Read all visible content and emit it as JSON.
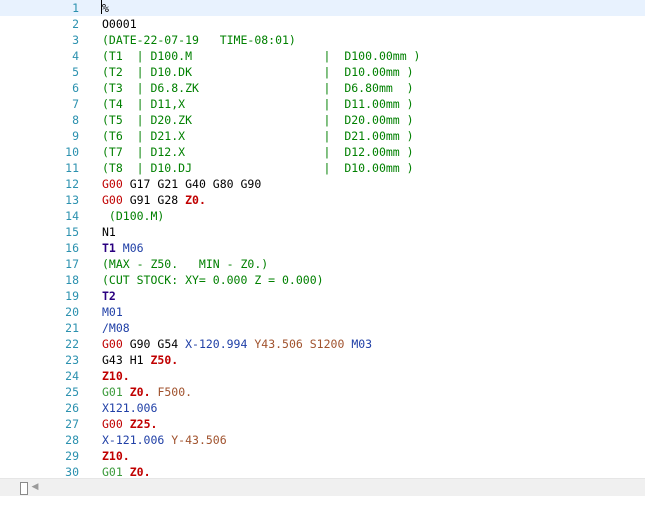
{
  "editor": {
    "lines": [
      {
        "n": "1",
        "tokens": [
          {
            "t": "%",
            "c": "pct"
          }
        ]
      },
      {
        "n": "2",
        "tokens": [
          {
            "t": "O0001",
            "c": "plain"
          }
        ]
      },
      {
        "n": "3",
        "tokens": [
          {
            "t": "(DATE-22-07-19   TIME-08:01)",
            "c": "comment"
          }
        ]
      },
      {
        "n": "4",
        "tokens": [
          {
            "t": "(T1  | D100.M                   |  D100.00mm )",
            "c": "comment"
          }
        ]
      },
      {
        "n": "5",
        "tokens": [
          {
            "t": "(T2  | D10.DK                   |  D10.00mm )",
            "c": "comment"
          }
        ]
      },
      {
        "n": "6",
        "tokens": [
          {
            "t": "(T3  | D6.8.ZK                  |  D6.80mm  )",
            "c": "comment"
          }
        ]
      },
      {
        "n": "7",
        "tokens": [
          {
            "t": "(T4  | D11,X                    |  D11.00mm )",
            "c": "comment"
          }
        ]
      },
      {
        "n": "8",
        "tokens": [
          {
            "t": "(T5  | D20.ZK                   |  D20.00mm )",
            "c": "comment"
          }
        ]
      },
      {
        "n": "9",
        "tokens": [
          {
            "t": "(T6  | D21.X                    |  D21.00mm )",
            "c": "comment"
          }
        ]
      },
      {
        "n": "10",
        "tokens": [
          {
            "t": "(T7  | D12.X                    |  D12.00mm )",
            "c": "comment"
          }
        ]
      },
      {
        "n": "11",
        "tokens": [
          {
            "t": "(T8  | D10.DJ                   |  D10.00mm )",
            "c": "comment"
          }
        ]
      },
      {
        "n": "12",
        "tokens": [
          {
            "t": "G00",
            "c": "g0"
          },
          {
            "t": " G17 G21 G40 G80 G90",
            "c": "g"
          }
        ]
      },
      {
        "n": "13",
        "tokens": [
          {
            "t": "G00",
            "c": "g0"
          },
          {
            "t": " G91 G28 ",
            "c": "g"
          },
          {
            "t": "Z0.",
            "c": "z"
          }
        ]
      },
      {
        "n": "14",
        "tokens": [
          {
            "t": " (D100.M)",
            "c": "comment"
          }
        ]
      },
      {
        "n": "15",
        "tokens": [
          {
            "t": "N1",
            "c": "plain"
          }
        ]
      },
      {
        "n": "16",
        "tokens": [
          {
            "t": "T1",
            "c": "t"
          },
          {
            "t": " M06",
            "c": "m"
          }
        ]
      },
      {
        "n": "17",
        "tokens": [
          {
            "t": "(MAX - Z50.   MIN - Z0.)",
            "c": "comment"
          }
        ]
      },
      {
        "n": "18",
        "tokens": [
          {
            "t": "(CUT STOCK: XY= 0.000 Z = 0.000)",
            "c": "comment"
          }
        ]
      },
      {
        "n": "19",
        "tokens": [
          {
            "t": "T2",
            "c": "t"
          }
        ]
      },
      {
        "n": "20",
        "tokens": [
          {
            "t": "M01",
            "c": "m"
          }
        ]
      },
      {
        "n": "21",
        "tokens": [
          {
            "t": "/M08",
            "c": "m"
          }
        ]
      },
      {
        "n": "22",
        "tokens": [
          {
            "t": "G00",
            "c": "g0"
          },
          {
            "t": " G90 G54 ",
            "c": "g"
          },
          {
            "t": "X-120.994",
            "c": "x"
          },
          {
            "t": " ",
            "c": "plain"
          },
          {
            "t": "Y43.506",
            "c": "y"
          },
          {
            "t": " ",
            "c": "plain"
          },
          {
            "t": "S1200",
            "c": "s"
          },
          {
            "t": " ",
            "c": "plain"
          },
          {
            "t": "M03",
            "c": "m"
          }
        ]
      },
      {
        "n": "23",
        "tokens": [
          {
            "t": "G43 H1 ",
            "c": "h"
          },
          {
            "t": "Z50.",
            "c": "z"
          }
        ]
      },
      {
        "n": "24",
        "tokens": [
          {
            "t": "Z10.",
            "c": "z"
          }
        ]
      },
      {
        "n": "25",
        "tokens": [
          {
            "t": "G01",
            "c": "g01"
          },
          {
            "t": " ",
            "c": "plain"
          },
          {
            "t": "Z0.",
            "c": "z"
          },
          {
            "t": " ",
            "c": "plain"
          },
          {
            "t": "F500.",
            "c": "f"
          }
        ]
      },
      {
        "n": "26",
        "tokens": [
          {
            "t": "X121.006",
            "c": "x"
          }
        ]
      },
      {
        "n": "27",
        "tokens": [
          {
            "t": "G00",
            "c": "g0"
          },
          {
            "t": " ",
            "c": "plain"
          },
          {
            "t": "Z25.",
            "c": "z"
          }
        ]
      },
      {
        "n": "28",
        "tokens": [
          {
            "t": "X-121.006",
            "c": "x"
          },
          {
            "t": " ",
            "c": "plain"
          },
          {
            "t": "Y-43.506",
            "c": "y"
          }
        ]
      },
      {
        "n": "29",
        "tokens": [
          {
            "t": "Z10.",
            "c": "z"
          }
        ]
      },
      {
        "n": "30",
        "tokens": [
          {
            "t": "G01",
            "c": "g01"
          },
          {
            "t": " ",
            "c": "plain"
          },
          {
            "t": "Z0.",
            "c": "z"
          }
        ]
      }
    ],
    "current_line": 1
  },
  "scrollbar": {
    "left_arrow": "◀",
    "left_arrow_icon": "chevron-left-icon"
  },
  "colors": {
    "comment": "#008000",
    "g_rapid": "#c00000",
    "z_word": "#c00000",
    "x_word": "#1f3fa6",
    "y_word": "#a0522d",
    "line_number": "#2b91af",
    "current_line_bg": "#e8f2fe"
  }
}
